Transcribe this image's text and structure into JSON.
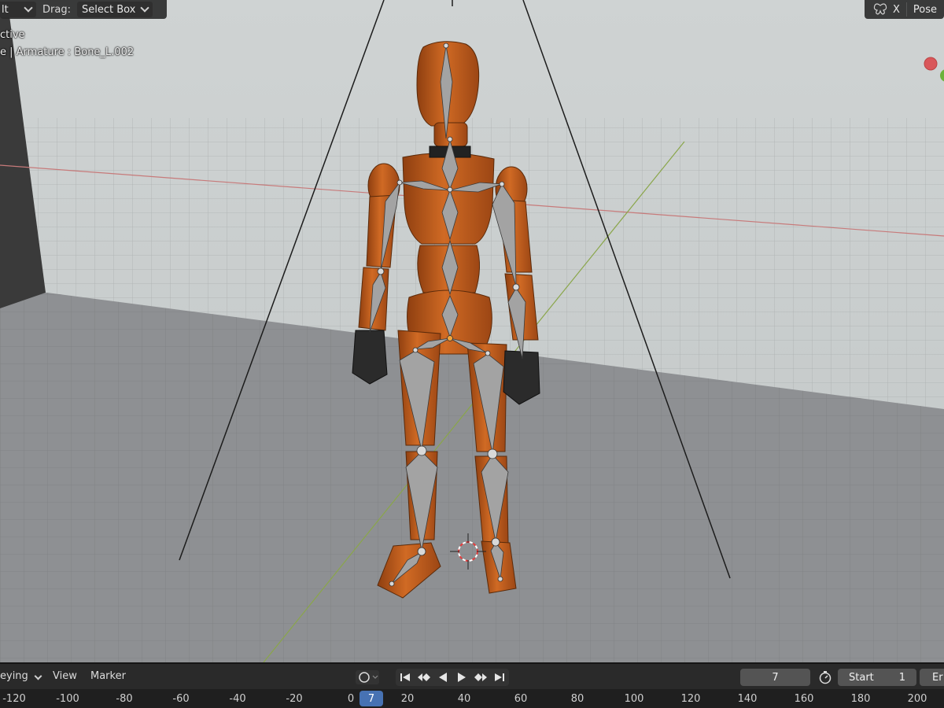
{
  "header": {
    "mode_dropdown_label": "lt",
    "drag_label": "Drag:",
    "drag_value": "Select Box",
    "pose_label": "Pose",
    "axis_x_label": "X"
  },
  "overlay": {
    "line1": "ctive",
    "line2": "e | Armature : Bone_L.002"
  },
  "timeline": {
    "keying_label": "eying",
    "view_label": "View",
    "marker_label": "Marker",
    "current_frame_value": "7",
    "start_label": "Start",
    "start_value": "1",
    "end_label_partial": "Er",
    "ruler_ticks": [
      "-120",
      "-100",
      "-80",
      "-60",
      "-40",
      "-20",
      "0",
      "20",
      "40",
      "60",
      "80",
      "100",
      "120",
      "140",
      "160",
      "180",
      "200"
    ],
    "playhead_frame": "7"
  },
  "icons": {
    "record": "record-circle-icon",
    "jump_start": "jump-to-start-icon",
    "prev_keyframe": "previous-keyframe-icon",
    "play_reverse": "play-reverse-icon",
    "play": "play-icon",
    "next_keyframe": "next-keyframe-icon",
    "jump_end": "jump-to-end-icon",
    "stopwatch": "stopwatch-icon",
    "mirror": "mirror-butterfly-icon"
  },
  "colors": {
    "accent_blue": "#4772b3",
    "model_orange": "#c2611f",
    "bone_gray": "#9a9a9a"
  }
}
